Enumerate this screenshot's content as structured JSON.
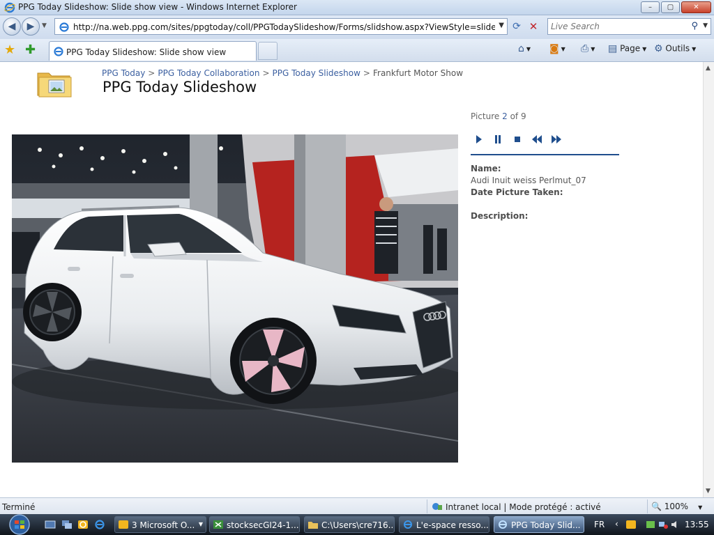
{
  "window": {
    "title": "PPG Today Slideshow: Slide show view - Windows Internet Explorer",
    "minimize": "–",
    "maximize": "▢",
    "close": "✕"
  },
  "address": {
    "url": "http://na.web.ppg.com/sites/ppgtoday/coll/PPGTodaySlideshow/Forms/slidshow.aspx?ViewStyle=slideshow&Roo",
    "search_placeholder": "Live Search"
  },
  "tab": {
    "label": "PPG Today Slideshow: Slide show view"
  },
  "commands": {
    "page": "Page",
    "tools": "Outils"
  },
  "page": {
    "breadcrumb": [
      {
        "label": "PPG Today"
      },
      {
        "label": "PPG Today Collaboration"
      },
      {
        "label": "PPG Today Slideshow"
      }
    ],
    "breadcrumb_current": "Frankfurt Motor Show",
    "breadcrumb_sep": ">",
    "title": "PPG Today Slideshow",
    "picture_prefix": "Picture",
    "picture_current": "2",
    "picture_of": "of 9",
    "name_label": "Name:",
    "name_value": "Audi Inuit weiss Perlmut_07",
    "date_label": "Date Picture Taken:",
    "description_label": "Description:"
  },
  "status": {
    "text": "Terminé",
    "zone": "Intranet local | Mode protégé : activé",
    "zoom": "100%"
  },
  "taskbar": {
    "tasks": [
      {
        "label": "3 Microsoft O..."
      },
      {
        "label": "stocksecGI24-1..."
      },
      {
        "label": "C:\\Users\\cre716..."
      },
      {
        "label": "L'e-space resso..."
      },
      {
        "label": "PPG Today Slid..."
      }
    ],
    "lang": "FR",
    "clock": "13:55"
  },
  "colors": {
    "link": "#3b5fa0",
    "rule": "#1f4e8d",
    "control": "#1f4e8d"
  }
}
